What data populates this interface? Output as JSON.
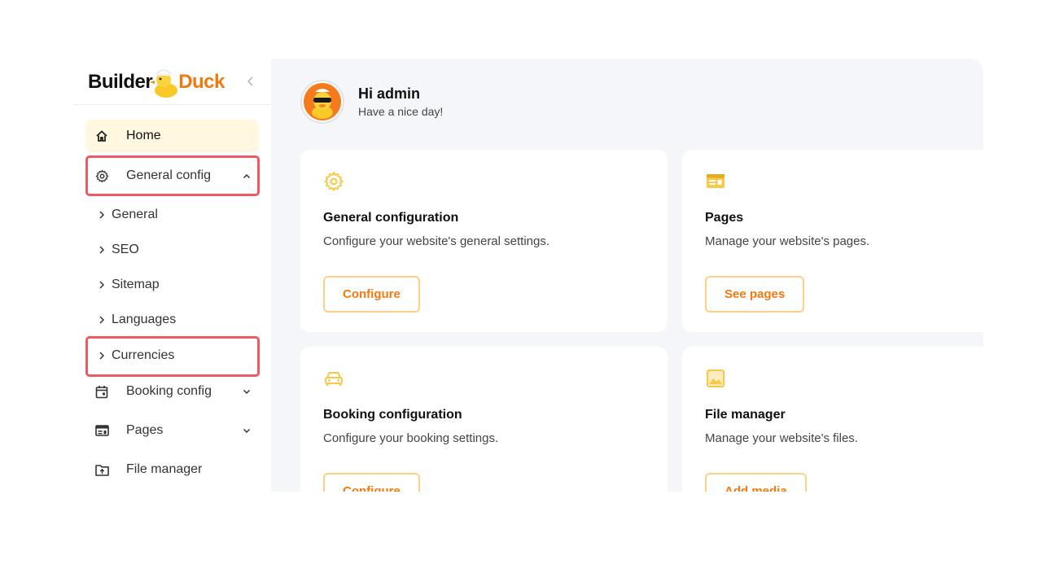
{
  "brand": {
    "part1": "Builder",
    "part2": "Duck"
  },
  "sidebar": {
    "items": [
      {
        "label": "Home",
        "icon": "home-icon"
      },
      {
        "label": "General config",
        "icon": "gear-icon",
        "expanded": true
      },
      {
        "label": "Booking config",
        "icon": "calendar-icon"
      },
      {
        "label": "Pages",
        "icon": "pages-icon"
      },
      {
        "label": "File manager",
        "icon": "folder-upload-icon"
      }
    ],
    "subitems": [
      {
        "label": "General"
      },
      {
        "label": "SEO"
      },
      {
        "label": "Sitemap"
      },
      {
        "label": "Languages"
      },
      {
        "label": "Currencies"
      }
    ]
  },
  "header": {
    "greeting": "Hi admin",
    "subtitle": "Have a nice day!"
  },
  "cards": [
    {
      "title": "General configuration",
      "description": "Configure your website's general settings.",
      "button": "Configure",
      "icon": "gear-icon"
    },
    {
      "title": "Pages",
      "description": "Manage your website's pages.",
      "button": "See pages",
      "icon": "pages-icon"
    },
    {
      "title": "Booking configuration",
      "description": "Configure your booking settings.",
      "button": "Configure",
      "icon": "car-icon"
    },
    {
      "title": "File manager",
      "description": "Manage your website's files.",
      "button": "Add media",
      "icon": "image-icon"
    }
  ],
  "colors": {
    "accent": "#f07a10",
    "icon_yellow": "#f7c948",
    "active_bg": "#fff7df",
    "highlight": "#ec5a62",
    "main_bg": "#f5f6f9"
  }
}
